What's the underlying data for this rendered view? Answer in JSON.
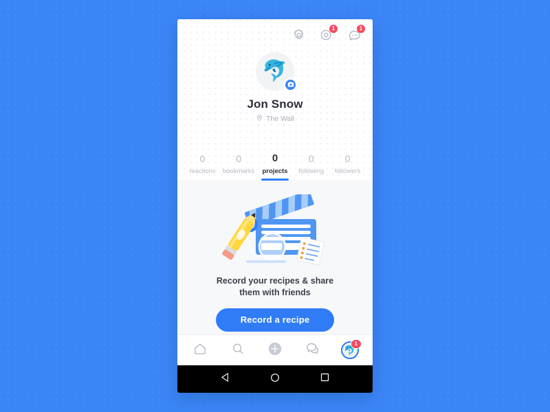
{
  "theme": {
    "page_background": "#3b86f7",
    "accent": "#2f7cf6",
    "badge_red": "#f8485e",
    "panel_background": "#f7f8fa",
    "muted_text": "#b6bac2",
    "dark_text": "#2b2f38"
  },
  "topbar": {
    "settings_icon": "gear-icon",
    "notifications_icon": "bell-icon",
    "notifications_badge": "1",
    "messages_icon": "chat-bubble-icon",
    "messages_badge": "1"
  },
  "profile": {
    "avatar_emoji": "🐬",
    "avatar_badge_icon": "camera-icon",
    "name": "Jon Snow",
    "location_icon": "location-pin-icon",
    "location": "The Wall"
  },
  "stats": [
    {
      "value": "0",
      "label": "reactions",
      "active": false
    },
    {
      "value": "0",
      "label": "bookmarks",
      "active": false
    },
    {
      "value": "0",
      "label": "projects",
      "active": true
    },
    {
      "value": "0",
      "label": "following",
      "active": false
    },
    {
      "value": "0",
      "label": "followers",
      "active": false
    }
  ],
  "empty_state": {
    "illustration": "clapperboard-pencil-magnifier-illustration",
    "line1": "Record your recipes & share",
    "line2": "them with friends",
    "cta_label": "Record a recipe"
  },
  "tabbar": {
    "items": [
      {
        "name": "home",
        "icon": "home-icon",
        "badge": ""
      },
      {
        "name": "search",
        "icon": "search-icon",
        "badge": ""
      },
      {
        "name": "add",
        "icon": "plus-circle-icon",
        "badge": ""
      },
      {
        "name": "messages",
        "icon": "chat-bubbles-icon",
        "badge": ""
      },
      {
        "name": "profile",
        "icon": "avatar-icon",
        "badge": "1",
        "emoji": "🐬"
      }
    ]
  },
  "sysnav": {
    "back_icon": "triangle-back-icon",
    "home_icon": "circle-home-icon",
    "recents_icon": "square-recents-icon"
  }
}
